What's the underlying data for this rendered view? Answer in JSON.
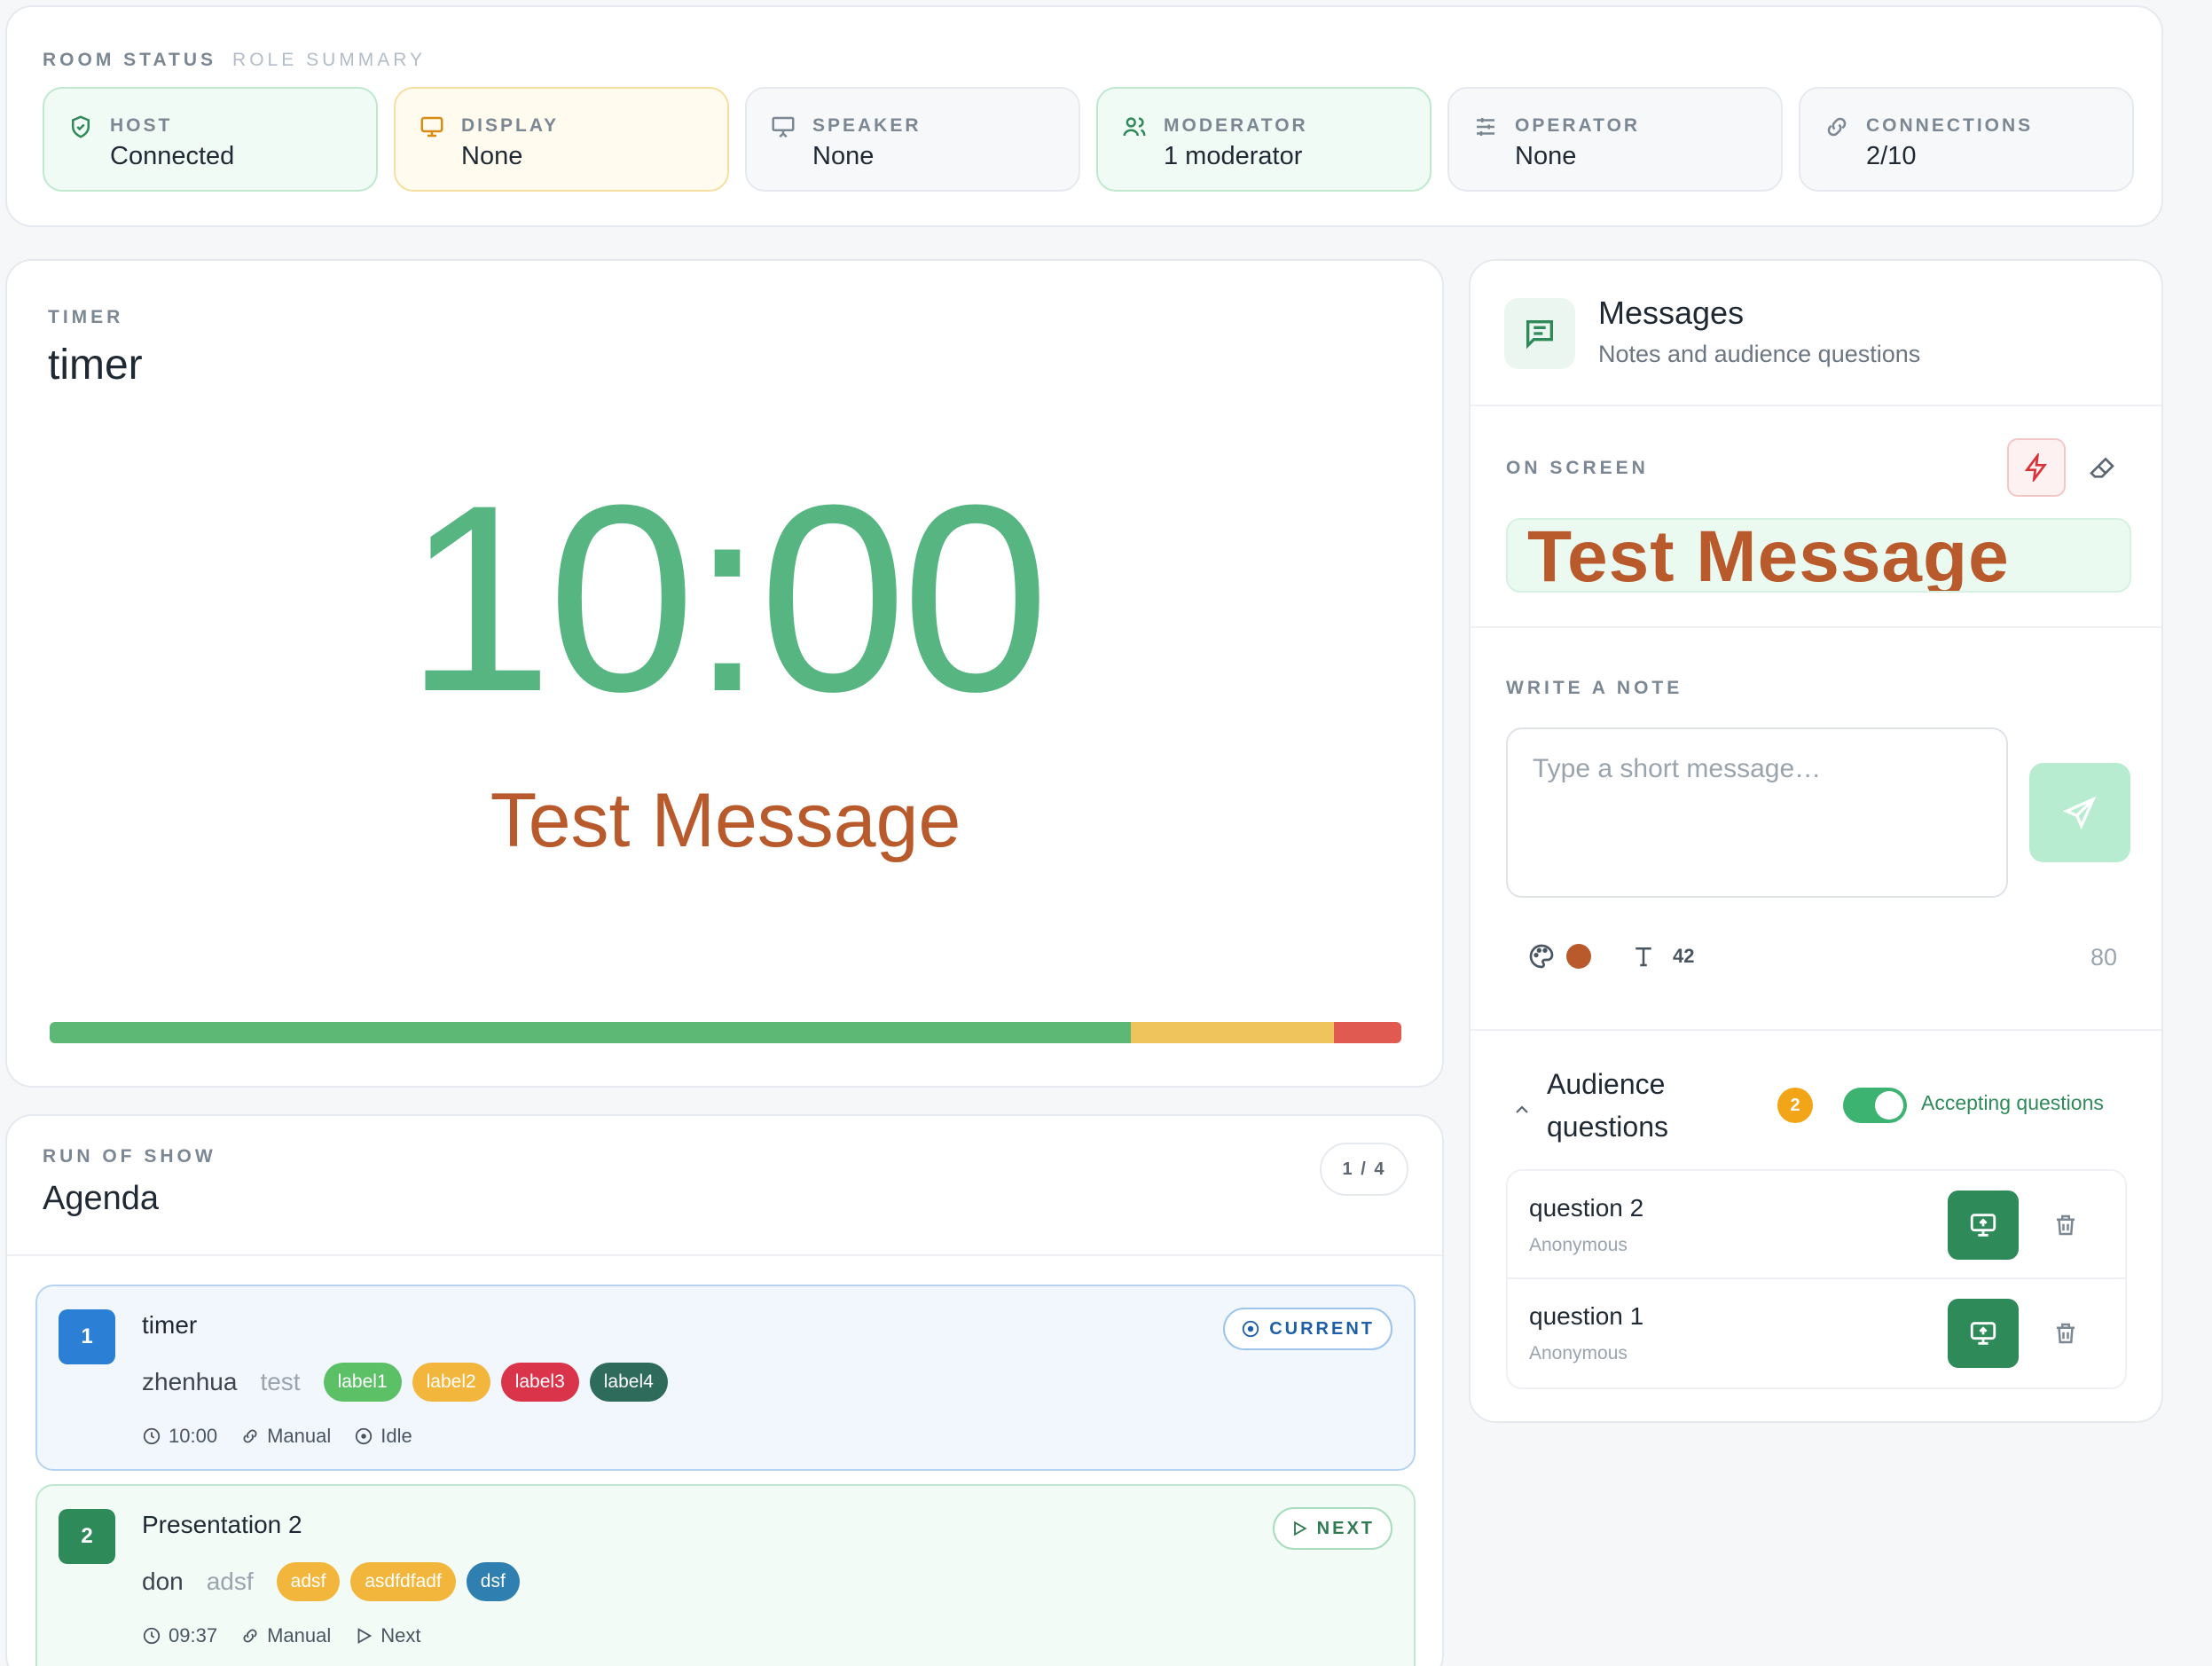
{
  "room_status": {
    "tab_active": "ROOM STATUS",
    "tab_inactive": "ROLE SUMMARY",
    "tiles": [
      {
        "label": "HOST",
        "value": "Connected",
        "icon": "shield-check-icon",
        "tone": "green"
      },
      {
        "label": "DISPLAY",
        "value": "None",
        "icon": "monitor-icon",
        "tone": "yellow"
      },
      {
        "label": "SPEAKER",
        "value": "None",
        "icon": "presentation-icon",
        "tone": "gray"
      },
      {
        "label": "MODERATOR",
        "value": "1 moderator",
        "icon": "users-icon",
        "tone": "green"
      },
      {
        "label": "OPERATOR",
        "value": "None",
        "icon": "sliders-icon",
        "tone": "gray"
      },
      {
        "label": "CONNECTIONS",
        "value": "2/10",
        "icon": "link-icon",
        "tone": "gray"
      }
    ]
  },
  "timer": {
    "eyebrow": "TIMER",
    "title": "timer",
    "display_time": "10:00",
    "message": "Test Message",
    "message_color": "#b85a2c",
    "time_color": "#57b582",
    "progress": {
      "green_fraction": 0.8,
      "yellow_fraction": 0.15,
      "red_fraction": 0.05,
      "colors": {
        "green": "#5cb874",
        "yellow": "#f0c45c",
        "red": "#e05a52"
      }
    }
  },
  "agenda": {
    "eyebrow": "RUN OF SHOW",
    "title": "Agenda",
    "pager": "1 / 4",
    "items": [
      {
        "number": "1",
        "title": "timer",
        "speaker": "zhenhua",
        "role": "test",
        "tags": [
          {
            "text": "label1",
            "color": "#5cc166"
          },
          {
            "text": "label2",
            "color": "#f2b63c"
          },
          {
            "text": "label3",
            "color": "#d9344a"
          },
          {
            "text": "label4",
            "color": "#2e6b5a"
          }
        ],
        "duration": "10:00",
        "mode": "Manual",
        "state": "Idle",
        "badge": "CURRENT"
      },
      {
        "number": "2",
        "title": "Presentation 2",
        "speaker": "don",
        "role": "adsf",
        "tags": [
          {
            "text": "adsf",
            "color": "#f2b63c"
          },
          {
            "text": "asdfdfadf",
            "color": "#f2b63c"
          },
          {
            "text": "dsf",
            "color": "#2f7fb0"
          }
        ],
        "duration": "09:37",
        "mode": "Manual",
        "state": "Next",
        "badge": "NEXT"
      }
    ]
  },
  "messages": {
    "title": "Messages",
    "subtitle": "Notes and audience questions",
    "on_screen_label": "ON SCREEN",
    "on_screen_text": "Test Message",
    "write_label": "WRITE A NOTE",
    "note_placeholder": "Type a short message…",
    "note_color": "#b85a2c",
    "font_size": "42",
    "char_limit": "80",
    "audience": {
      "title": "Audience questions",
      "count": "2",
      "accepting_label": "Accepting questions",
      "accepting": true,
      "questions": [
        {
          "text": "question 2",
          "author": "Anonymous"
        },
        {
          "text": "question 1",
          "author": "Anonymous"
        }
      ]
    }
  }
}
